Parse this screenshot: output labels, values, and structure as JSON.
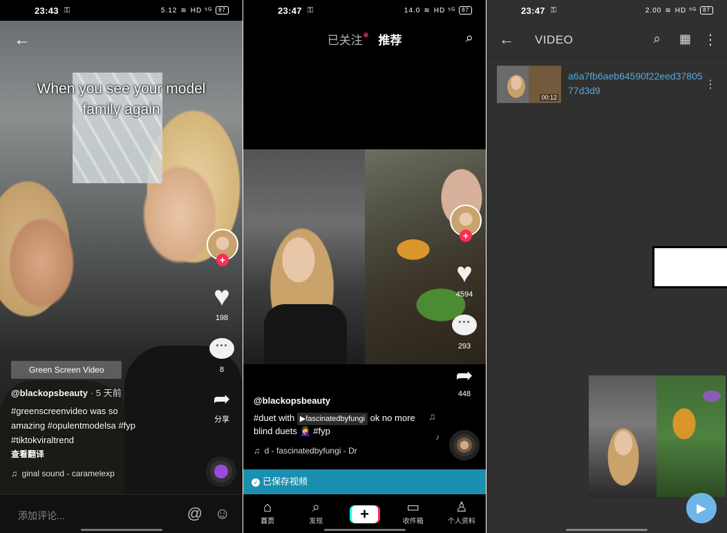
{
  "panel1": {
    "status": {
      "time": "23:43",
      "net": "5.12",
      "signal": "HD ⁵ᴳ",
      "battery": "87"
    },
    "caption_line1": "When you see your model",
    "caption_line2": "family again",
    "like_count": "198",
    "comment_count": "8",
    "share_label": "分享",
    "effect_tag": "Green Screen Video",
    "username": "@blackopsbeauty",
    "posted_ago": "· 5 天前",
    "description": "#greenscreenvideo was so amazing #opulentmodelsa #fyp #tiktokviraltrend",
    "translate_label": "查看翻译",
    "sound": "ginal sound - caramelexp",
    "comment_placeholder": "添加评论..."
  },
  "panel2": {
    "status": {
      "time": "23:47",
      "net": "14.0",
      "signal": "HD ⁵ᴳ",
      "battery": "87"
    },
    "tab_following": "已关注",
    "tab_recommended": "推荐",
    "like_count": "4594",
    "comment_count": "293",
    "share_count": "448",
    "username": "@blackopsbeauty",
    "desc_prefix": "#duet with",
    "duet_chip": "▶fascinatedbyfungi",
    "desc_suffix": "ok no more blind duets 🤦‍♀️ #fyp",
    "sound": "d - fascinatedbyfungi - Dr",
    "toast": "已保存视频",
    "nav": [
      {
        "icon": "⌂",
        "label": "首页"
      },
      {
        "icon": "⌕",
        "label": "发现"
      },
      {
        "icon": "+",
        "label": ""
      },
      {
        "icon": "▭",
        "label": "收件箱"
      },
      {
        "icon": "♙",
        "label": "个人资料"
      }
    ]
  },
  "panel3": {
    "status": {
      "time": "23:47",
      "net": "2.00",
      "signal": "HD ⁵ᴳ",
      "battery": "87"
    },
    "title": "VIDEO",
    "file_name": "a6a7fb6aeb64590f22eed3780577d3d9",
    "duration": "00:12"
  }
}
